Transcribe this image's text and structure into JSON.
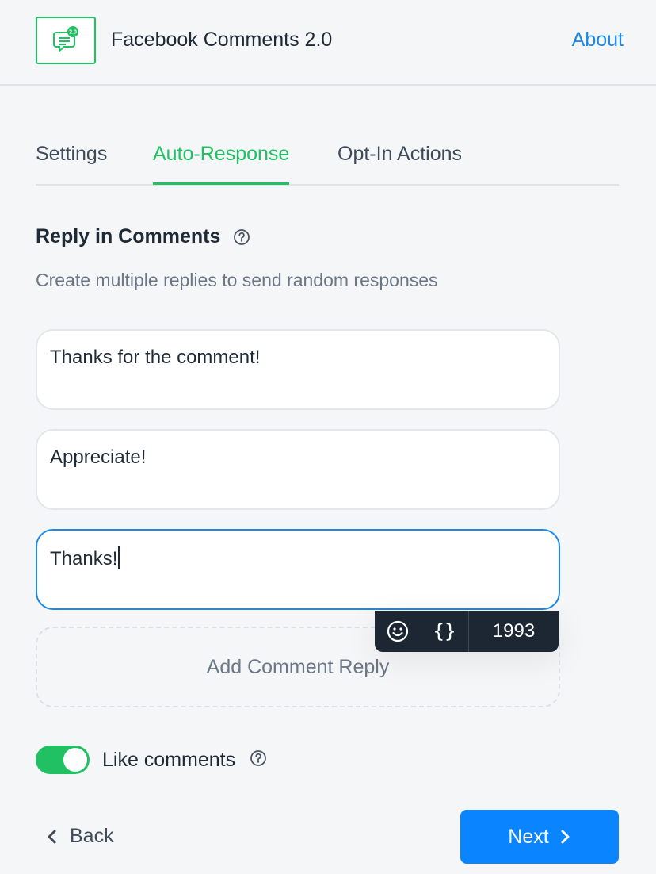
{
  "header": {
    "app_title": "Facebook Comments 2.0",
    "app_icon": "comment-badge-icon",
    "app_icon_badge": "2.0",
    "about_label": "About"
  },
  "tabs": [
    {
      "label": "Settings",
      "active": false
    },
    {
      "label": "Auto-Response",
      "active": true
    },
    {
      "label": "Opt-In Actions",
      "active": false
    }
  ],
  "section": {
    "title": "Reply in Comments",
    "description": "Create multiple replies to send random responses"
  },
  "replies": [
    {
      "text": "Thanks for the comment!",
      "focused": false
    },
    {
      "text": "Appreciate!",
      "focused": false
    },
    {
      "text": "Thanks!",
      "focused": true
    }
  ],
  "toolbar": {
    "emoji_icon": "smiley-icon",
    "variable_label": "{}",
    "char_count": "1993"
  },
  "add_reply_label": "Add Comment Reply",
  "like_comments": {
    "label": "Like comments",
    "enabled": true
  },
  "footer": {
    "back_label": "Back",
    "next_label": "Next"
  },
  "colors": {
    "accent_green": "#20c063",
    "primary_blue": "#0a84ff",
    "link_blue": "#1e88e5",
    "toolbar_dark": "#1c2733"
  }
}
